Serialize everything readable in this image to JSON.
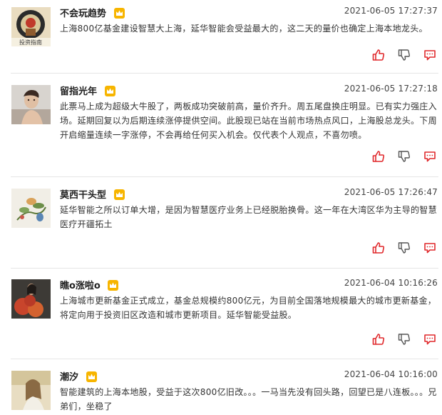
{
  "comments": [
    {
      "username": "不会玩趋势",
      "timestamp": "2021-06-05 17:27:37",
      "text": "上海800亿基金建设智慧大上海，延华智能会受益最大的，这二天的量价也确定上海本地龙头。",
      "avatar_caption": "投资指南"
    },
    {
      "username": "留指光年",
      "timestamp": "2021-06-05 17:27:18",
      "text": "此票马上成为超级大牛股了，两板成功突破前高，量价齐升。周五尾盘换庄明显。已有实力强庄入场。延期回复以为后期连续涨停提供空间。此股现已站在当前市场热点风口，上海股总龙头。下周开启缩量连续一字涨停，不会再给任何买入机会。仅代表个人观点，不喜勿喷。"
    },
    {
      "username": "莫西干头型",
      "timestamp": "2021-06-05 17:26:47",
      "text": "延华智能之所以订单大增，是因为智慧医疗业务上已经脱胎换骨。这一年在大湾区华为主导的智慧医疗开疆拓土"
    },
    {
      "username": "瞧o涨啦o",
      "timestamp": "2021-06-04 10:16:26",
      "text": "上海城市更新基金正式成立，基金总规模约800亿元，为目前全国落地规模最大的城市更新基金，将定向用于投资旧区改造和城市更新项目。延华智能受益股。"
    },
    {
      "username": "潮汐",
      "timestamp": "2021-06-04 10:16:00",
      "text": "智能建筑的上海本地股，受益于这次800亿旧改。。。一马当先没有回头路，回望已是八连板。。。兄弟们，坐稳了"
    }
  ],
  "icons": {
    "like": "thumbs-up-icon",
    "dislike": "thumbs-down-icon",
    "reply": "comment-bubble-icon",
    "vip": "crown-icon"
  },
  "colors": {
    "action_red": "#e0292c",
    "vip_gold": "#f7b500",
    "divider": "#e6e6e6"
  }
}
